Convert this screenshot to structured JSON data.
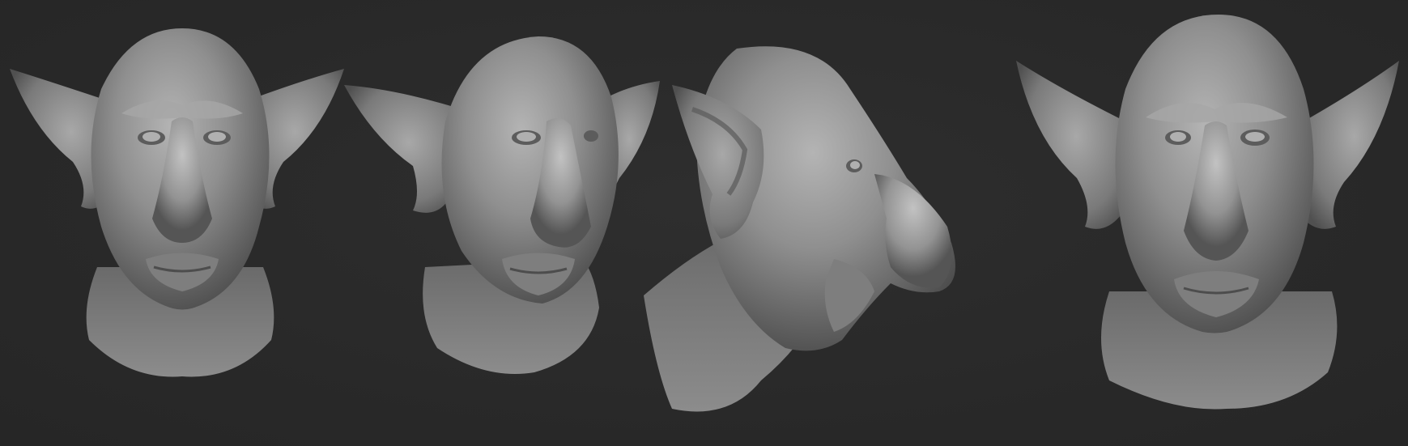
{
  "scene": {
    "background_color": "#2a2a2a",
    "material_color": "#8a8a8a",
    "views": [
      {
        "name": "front",
        "icon": "goblin-head-front"
      },
      {
        "name": "three-quarter",
        "icon": "goblin-head-three-quarter"
      },
      {
        "name": "profile",
        "icon": "goblin-head-profile"
      },
      {
        "name": "front-lit",
        "icon": "goblin-head-front-alt"
      }
    ]
  }
}
